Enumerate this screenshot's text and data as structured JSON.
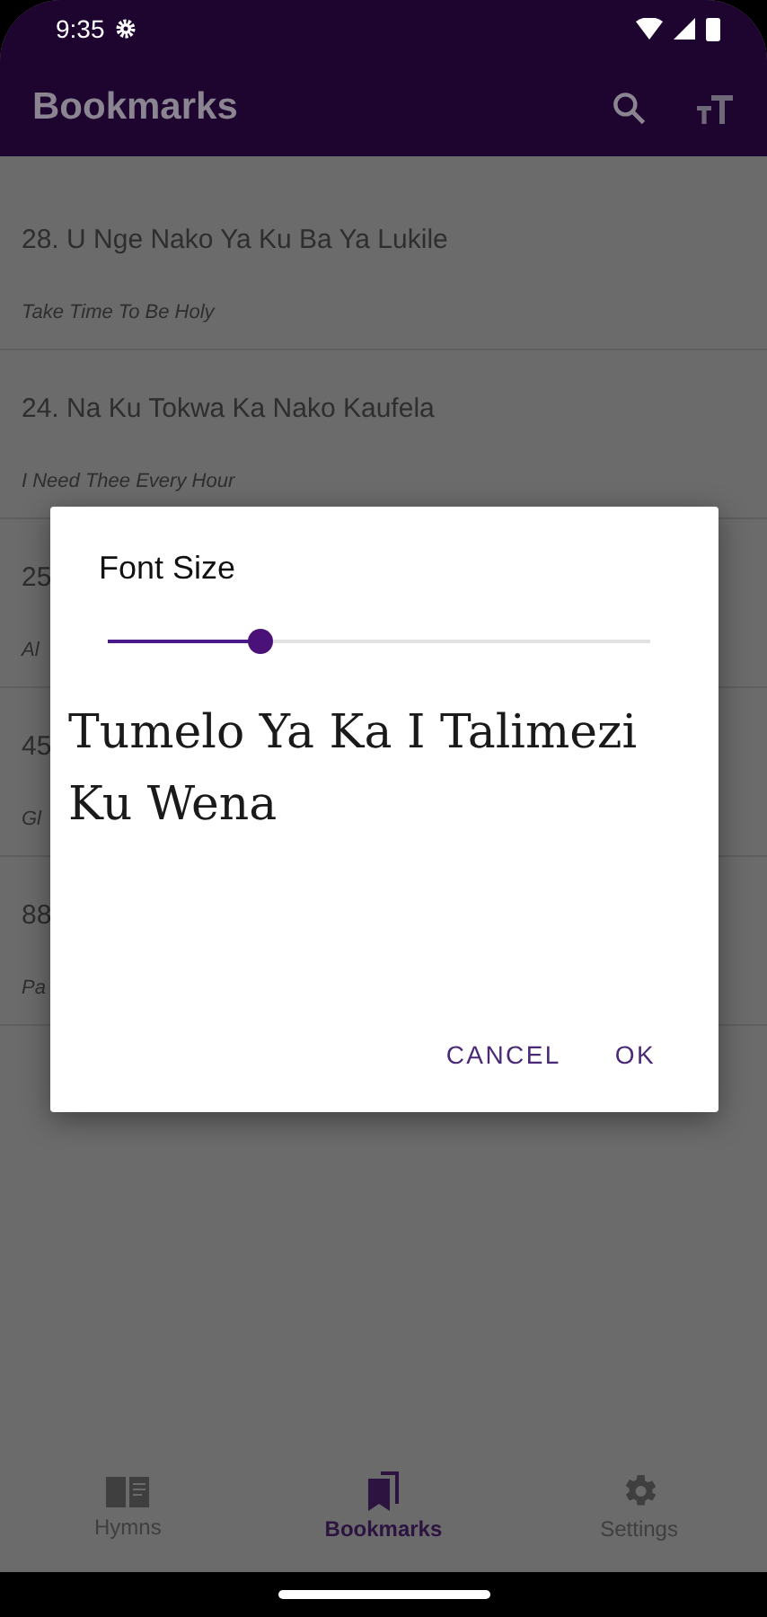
{
  "status_bar": {
    "time": "9:35"
  },
  "app_bar": {
    "title": "Bookmarks"
  },
  "bookmarks": [
    {
      "title": "28. U Nge Nako Ya Ku Ba Ya Lukile",
      "subtitle": "Take Time To Be Holy"
    },
    {
      "title": "24. Na Ku Tokwa Ka Nako Kaufela",
      "subtitle": "I Need Thee Every Hour"
    },
    {
      "title": "25",
      "subtitle": "Al"
    },
    {
      "title": "45",
      "subtitle": "Gl"
    },
    {
      "title": "88",
      "subtitle": "Pa"
    }
  ],
  "dialog": {
    "title": "Font Size",
    "slider": {
      "level": 0.28
    },
    "preview": "Tumelo Ya Ka I Talimezi Ku Wena",
    "buttons": [
      "CANCEL",
      "OK"
    ]
  },
  "bottom_nav": [
    {
      "label": "Hymns",
      "kind": "book",
      "selected": false
    },
    {
      "label": "Bookmarks",
      "kind": "bookmarks",
      "selected": true
    },
    {
      "label": "Settings",
      "kind": "gear",
      "selected": false
    }
  ]
}
